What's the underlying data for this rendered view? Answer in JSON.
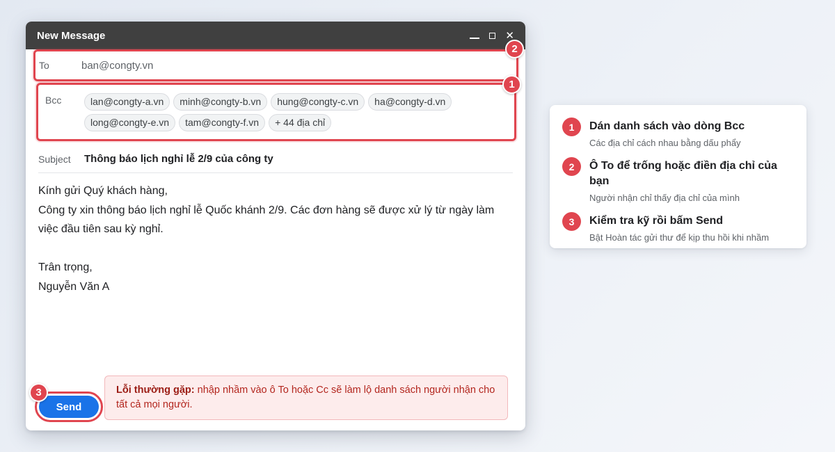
{
  "window": {
    "title": "New Message",
    "controls": {
      "minimize": "—",
      "maximize": "□",
      "close": "✕"
    }
  },
  "to": {
    "label": "To",
    "value": "ban@congty.vn",
    "badge": "2"
  },
  "bcc": {
    "label": "Bcc",
    "badge": "1",
    "chips": [
      "lan@congty-a.vn",
      "minh@congty-b.vn",
      "hung@congty-c.vn",
      "ha@congty-d.vn",
      "long@congty-e.vn",
      "tam@congty-f.vn",
      "+ 44 địa chỉ"
    ]
  },
  "subject": {
    "label": "Subject",
    "value": "Thông báo lịch nghỉ lễ 2/9 của công ty"
  },
  "body": {
    "greeting": "Kính gửi Quý khách hàng,",
    "paragraph": "Công ty xin thông báo lịch nghỉ lễ Quốc khánh 2/9. Các đơn hàng sẽ được xử lý từ ngày làm việc đầu tiên sau kỳ nghỉ.",
    "closing": "Trân trọng,",
    "signature": "Nguyễn Văn A"
  },
  "send": {
    "label": "Send",
    "badge": "3"
  },
  "warning": {
    "strong": "Lỗi thường gặp:",
    "text": " nhập nhầm vào ô To hoặc Cc sẽ làm lộ danh sách người nhận cho tất cả mọi người."
  },
  "steps": [
    {
      "num": "1",
      "title": "Dán danh sách vào dòng Bcc",
      "sub": "Các địa chỉ cách nhau bằng dấu phẩy"
    },
    {
      "num": "2",
      "title": "Ô To để trống hoặc điền địa chỉ của bạn",
      "sub": "Người nhận chỉ thấy địa chỉ của mình"
    },
    {
      "num": "3",
      "title": "Kiểm tra kỹ rồi bấm Send",
      "sub": "Bật Hoàn tác gửi thư để kịp thu hồi khi nhầm"
    }
  ],
  "colors": {
    "accent": "#e0454f",
    "send": "#1a73e8",
    "titlebar": "#404040"
  }
}
